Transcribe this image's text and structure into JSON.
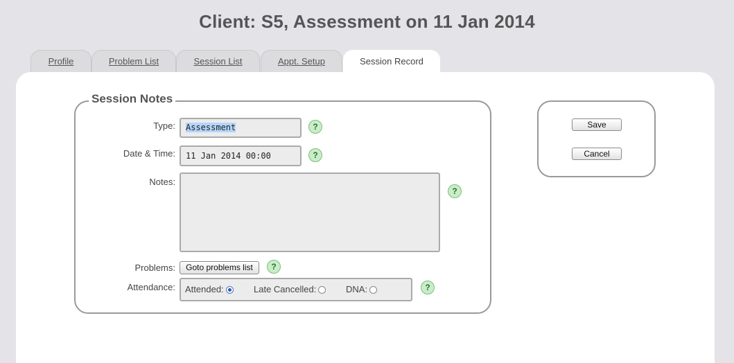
{
  "header": {
    "title": "Client: S5, Assessment on 11 Jan 2014"
  },
  "tabs": [
    {
      "label": "Profile"
    },
    {
      "label": "Problem List"
    },
    {
      "label": "Session List"
    },
    {
      "label": "Appt. Setup"
    },
    {
      "label": "Session Record",
      "active": true
    }
  ],
  "session_notes": {
    "legend": "Session Notes",
    "type_label": "Type:",
    "type_value": "Assessment",
    "datetime_label": "Date & Time:",
    "datetime_value": "11 Jan 2014 00:00",
    "notes_label": "Notes:",
    "notes_value": "",
    "problems_label": "Problems:",
    "goto_problems_button": "Goto problems list",
    "attendance_label": "Attendance:",
    "attendance_options": [
      {
        "label": "Attended:",
        "selected": true
      },
      {
        "label": "Late Cancelled:",
        "selected": false
      },
      {
        "label": "DNA:",
        "selected": false
      }
    ],
    "help_glyph": "?"
  },
  "actions": {
    "save_label": "Save",
    "cancel_label": "Cancel"
  },
  "colors": {
    "help_bg": "#c9ecc9",
    "selection": "#b5d5fb",
    "background": "#e4e4e8"
  }
}
